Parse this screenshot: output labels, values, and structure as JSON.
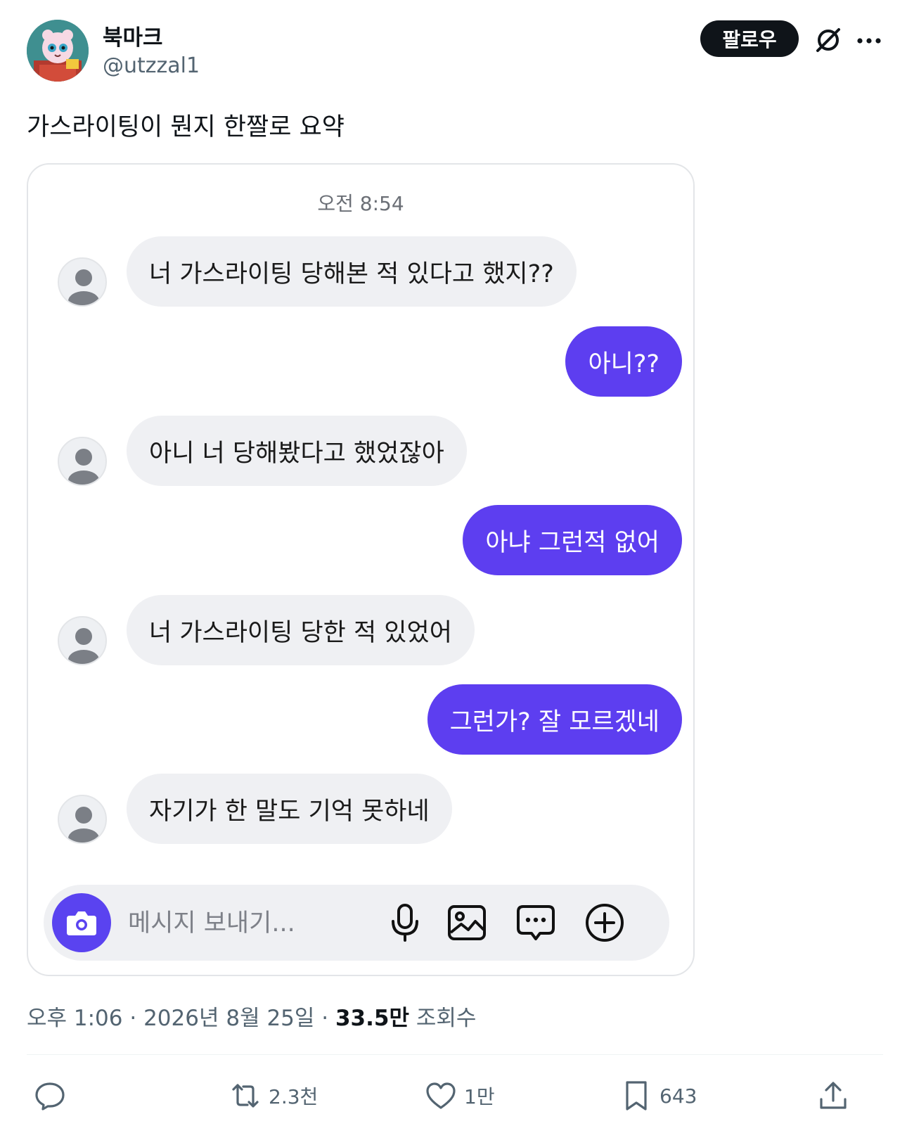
{
  "author": {
    "display_name": "북마크",
    "handle": "@utzzal1"
  },
  "header": {
    "follow_label": "팔로우"
  },
  "tweet": {
    "text": "가스라이팅이 뭔지 한짤로 요약"
  },
  "chat": {
    "time": "오전 8:54",
    "messages": [
      {
        "side": "in",
        "text": "너 가스라이팅 당해본 적 있다고 했지??"
      },
      {
        "side": "out",
        "text": "아니??"
      },
      {
        "side": "in",
        "text": "아니 너 당해봤다고 했었잖아"
      },
      {
        "side": "out",
        "text": "아냐 그런적 없어"
      },
      {
        "side": "in",
        "text": "너 가스라이팅 당한 적 있었어"
      },
      {
        "side": "out",
        "text": "그런가? 잘 모르겠네"
      },
      {
        "side": "in",
        "text": "자기가 한 말도 기억 못하네"
      }
    ],
    "composer_placeholder": "메시지 보내기...",
    "accent_color": "#5d3ef0"
  },
  "meta": {
    "time": "오후 1:06",
    "separator1": " · ",
    "date": "2026년 8월 25일",
    "separator2": " · ",
    "views_count": "33.5만",
    "views_label": "조회수"
  },
  "actions": {
    "reply_icon": "comment-icon",
    "retweet_count": "2.3천",
    "like_count": "1만",
    "bookmark_count": "643",
    "share_icon": "share-icon"
  }
}
